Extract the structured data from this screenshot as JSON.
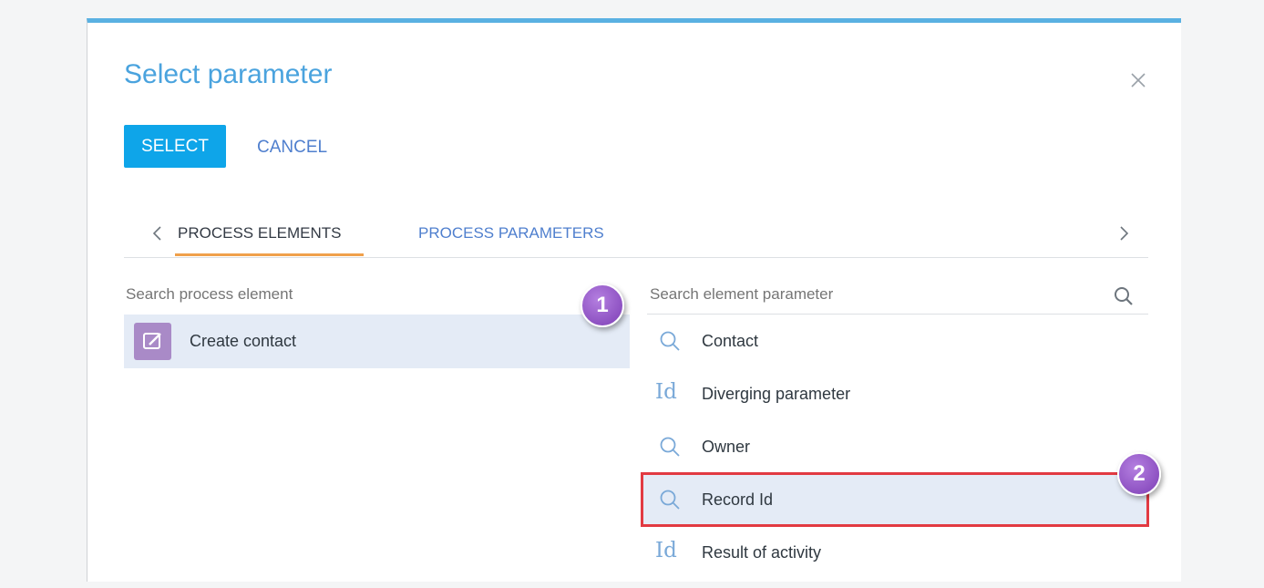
{
  "dialog": {
    "title": "Select parameter",
    "select_label": "SELECT",
    "cancel_label": "CANCEL"
  },
  "tabs": [
    {
      "label": "PROCESS ELEMENTS",
      "active": true
    },
    {
      "label": "PROCESS PARAMETERS",
      "active": false
    }
  ],
  "left_panel": {
    "search_placeholder": "Search process element",
    "items": [
      {
        "label": "Create contact",
        "icon": "edit-icon",
        "selected": true
      }
    ]
  },
  "right_panel": {
    "search_placeholder": "Search element parameter",
    "items": [
      {
        "label": "Contact",
        "icon": "search-icon"
      },
      {
        "label": "Diverging parameter",
        "icon": "Id"
      },
      {
        "label": "Owner",
        "icon": "search-icon"
      },
      {
        "label": "Record Id",
        "icon": "search-icon",
        "selected": true
      },
      {
        "label": "Result of activity",
        "icon": "Id"
      }
    ]
  },
  "annotations": {
    "badge_1": "1",
    "badge_2": "2"
  },
  "colors": {
    "accent": "#0ea5e9",
    "title": "#4aa3de",
    "link": "#4f7fce",
    "tab_underline": "#f0a04b",
    "selection_bg": "#e4ebf6",
    "highlight_border": "#e23a42",
    "badge": "#8a47c4"
  }
}
